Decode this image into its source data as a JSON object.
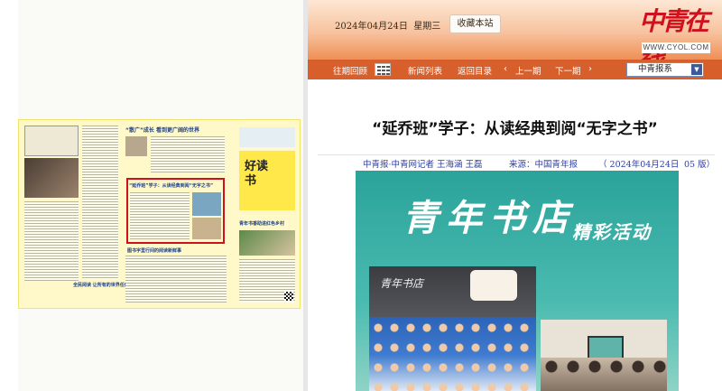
{
  "header": {
    "date": "2024年04月24日",
    "weekday": "星期三",
    "favorite_label": "收藏本站",
    "logo_text": "中青在线",
    "logo_url": "WWW.CYOL.COM"
  },
  "nav": {
    "items": [
      "往期回顾",
      "新闻列表",
      "返回目录",
      "上一期",
      "下一期"
    ],
    "select_value": "中青报系"
  },
  "paper_thumbnail": {
    "headlines": [
      "“好读书”",
      "“散广”成长  看到更广阔的世界",
      "“延乔班”学子：从读经典到阅“无字之书”",
      "青年书香助进红色乡村",
      "全民阅读  让所有的世界任何地方",
      "图书字里行间的阅读新鲜事"
    ],
    "side_banner": "好读书"
  },
  "article": {
    "title": "“延乔班”学子：从读经典到阅“无字之书”",
    "byline": "中青报·中青网记者  王海涵  王磊",
    "source": "来源：中国青年报",
    "date": "（ 2024年04月24日",
    "page": "05 版）"
  },
  "article_image": {
    "calligraphy_main": "青年书店",
    "calligraphy_sub": "精彩活动",
    "store_sign": "青年书店"
  },
  "colors": {
    "accent": "#d75f2c",
    "link": "#2f3fa0",
    "highlight": "#d0111d"
  }
}
